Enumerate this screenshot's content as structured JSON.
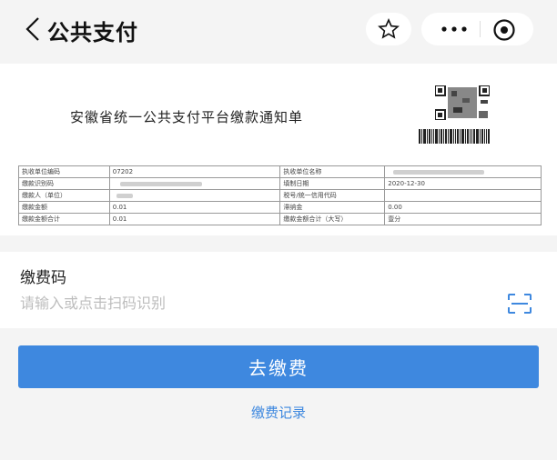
{
  "header": {
    "title": "公共支付",
    "back_icon": "chevron-left-icon",
    "star_icon": "star-icon",
    "more_icon": "more-icon",
    "target_icon": "target-icon"
  },
  "notice": {
    "title": "安徽省统一公共支付平台缴款通知单",
    "rows": [
      [
        "执收单位编码",
        "07202",
        "执收单位名称",
        ""
      ],
      [
        "缴款识别码",
        "",
        "填制日期",
        "2020-12-30"
      ],
      [
        "缴款人（单位）",
        "",
        "税号/统一信用代码",
        ""
      ],
      [
        "缴款金额",
        "0.01",
        "滞纳金",
        "0.00"
      ],
      [
        "缴款金额合计",
        "0.01",
        "缴款金额合计（大写）",
        "壹分"
      ]
    ]
  },
  "paycode": {
    "label": "缴费码",
    "placeholder": "请输入或点击扫码识别",
    "value": "",
    "scan_icon": "scan-icon"
  },
  "actions": {
    "pay_label": "去缴费",
    "records_label": "缴费记录"
  },
  "colors": {
    "accent": "#3e88df",
    "background": "#f4f4f4"
  }
}
